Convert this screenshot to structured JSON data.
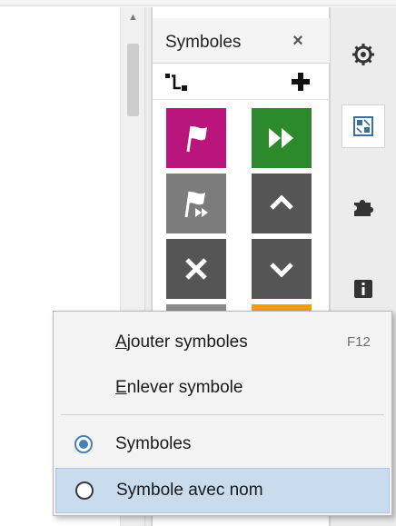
{
  "panel": {
    "title": "Symboles",
    "close_glyph": "×"
  },
  "symbols": [
    {
      "name": "flag-pink",
      "color": "#b9157c",
      "icon": "flag-icon"
    },
    {
      "name": "fast-forward-green",
      "color": "#2c8a2c",
      "icon": "fast-forward-icon"
    },
    {
      "name": "flag-forward-gray",
      "color": "#7c7c7c",
      "icon": "flag-forward-icon"
    },
    {
      "name": "up-dark",
      "color": "#555555",
      "icon": "chevron-up-icon"
    },
    {
      "name": "cross-dark",
      "color": "#555555",
      "icon": "cross-icon"
    },
    {
      "name": "down-dark",
      "color": "#555555",
      "icon": "chevron-down-icon"
    }
  ],
  "right_toolbar": [
    "gear-icon",
    "symbols-panel-icon",
    "puzzle-icon",
    "info-icon"
  ],
  "menu": {
    "items": [
      {
        "label_pre": "",
        "label_u": "A",
        "label_post": "jouter symboles",
        "shortcut": "F12"
      },
      {
        "label_pre": "",
        "label_u": "E",
        "label_post": "nlever symbole",
        "shortcut": ""
      }
    ],
    "radios": [
      {
        "label": "Symboles",
        "checked": true
      },
      {
        "label": "Symbole avec nom",
        "checked": false
      }
    ]
  },
  "colors": {
    "menu_hover": "#c9dced",
    "radio_accent": "#4a7fb2",
    "orange_peek": "#f39c12"
  }
}
